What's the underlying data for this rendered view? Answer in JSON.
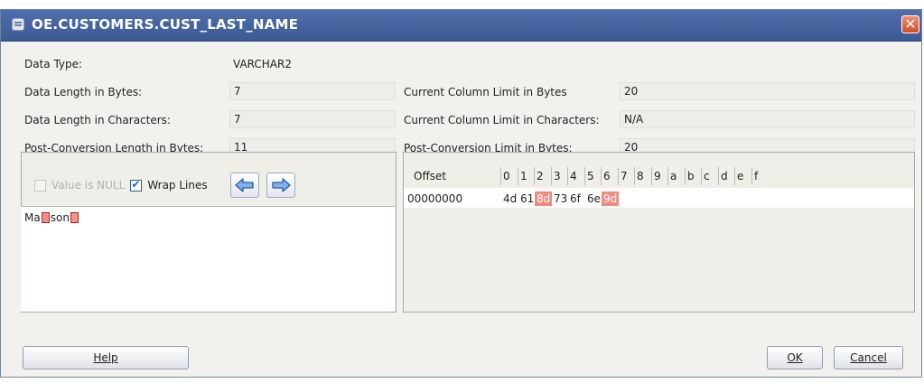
{
  "window": {
    "title": "OE.CUSTOMERS.CUST_LAST_NAME",
    "close_label": "✕"
  },
  "fields": {
    "data_type": {
      "label": "Data Type:",
      "value": "VARCHAR2"
    },
    "data_length_bytes": {
      "label": "Data Length in Bytes:",
      "value": "7"
    },
    "data_length_chars": {
      "label": "Data Length in Characters:",
      "value": "7"
    },
    "post_conversion_length": {
      "label": "Post-Conversion Length in Bytes:",
      "value": "11"
    },
    "column_limit_bytes": {
      "label": "Current Column Limit in Bytes",
      "value": "20"
    },
    "column_limit_chars": {
      "label": "Current Column Limit in Characters:",
      "value": "N/A"
    },
    "post_conversion_limit": {
      "label": "Post-Conversion Limit in Bytes:",
      "value": "20"
    }
  },
  "options": {
    "value_is_null": {
      "label": "Value is NULL",
      "checked": false,
      "enabled": false
    },
    "wrap_lines": {
      "label": "Wrap Lines",
      "checked": true
    }
  },
  "text_value": {
    "part1": "Ma",
    "part2": "son"
  },
  "hex": {
    "offset_header": "Offset",
    "columns": [
      "0",
      "1",
      "2",
      "3",
      "4",
      "5",
      "6",
      "7",
      "8",
      "9",
      "a",
      "b",
      "c",
      "d",
      "e",
      "f"
    ],
    "row_offset": "00000000",
    "bytes": [
      "4d",
      "61",
      "8d",
      "73",
      "6f",
      "6e",
      "9d"
    ],
    "highlighted": [
      2,
      6
    ]
  },
  "buttons": {
    "help": "Help",
    "ok": "OK",
    "cancel": "Cancel"
  },
  "colors": {
    "title_bar": "#3f5f99",
    "highlight": "#f08b80",
    "close": "#d44a24"
  }
}
